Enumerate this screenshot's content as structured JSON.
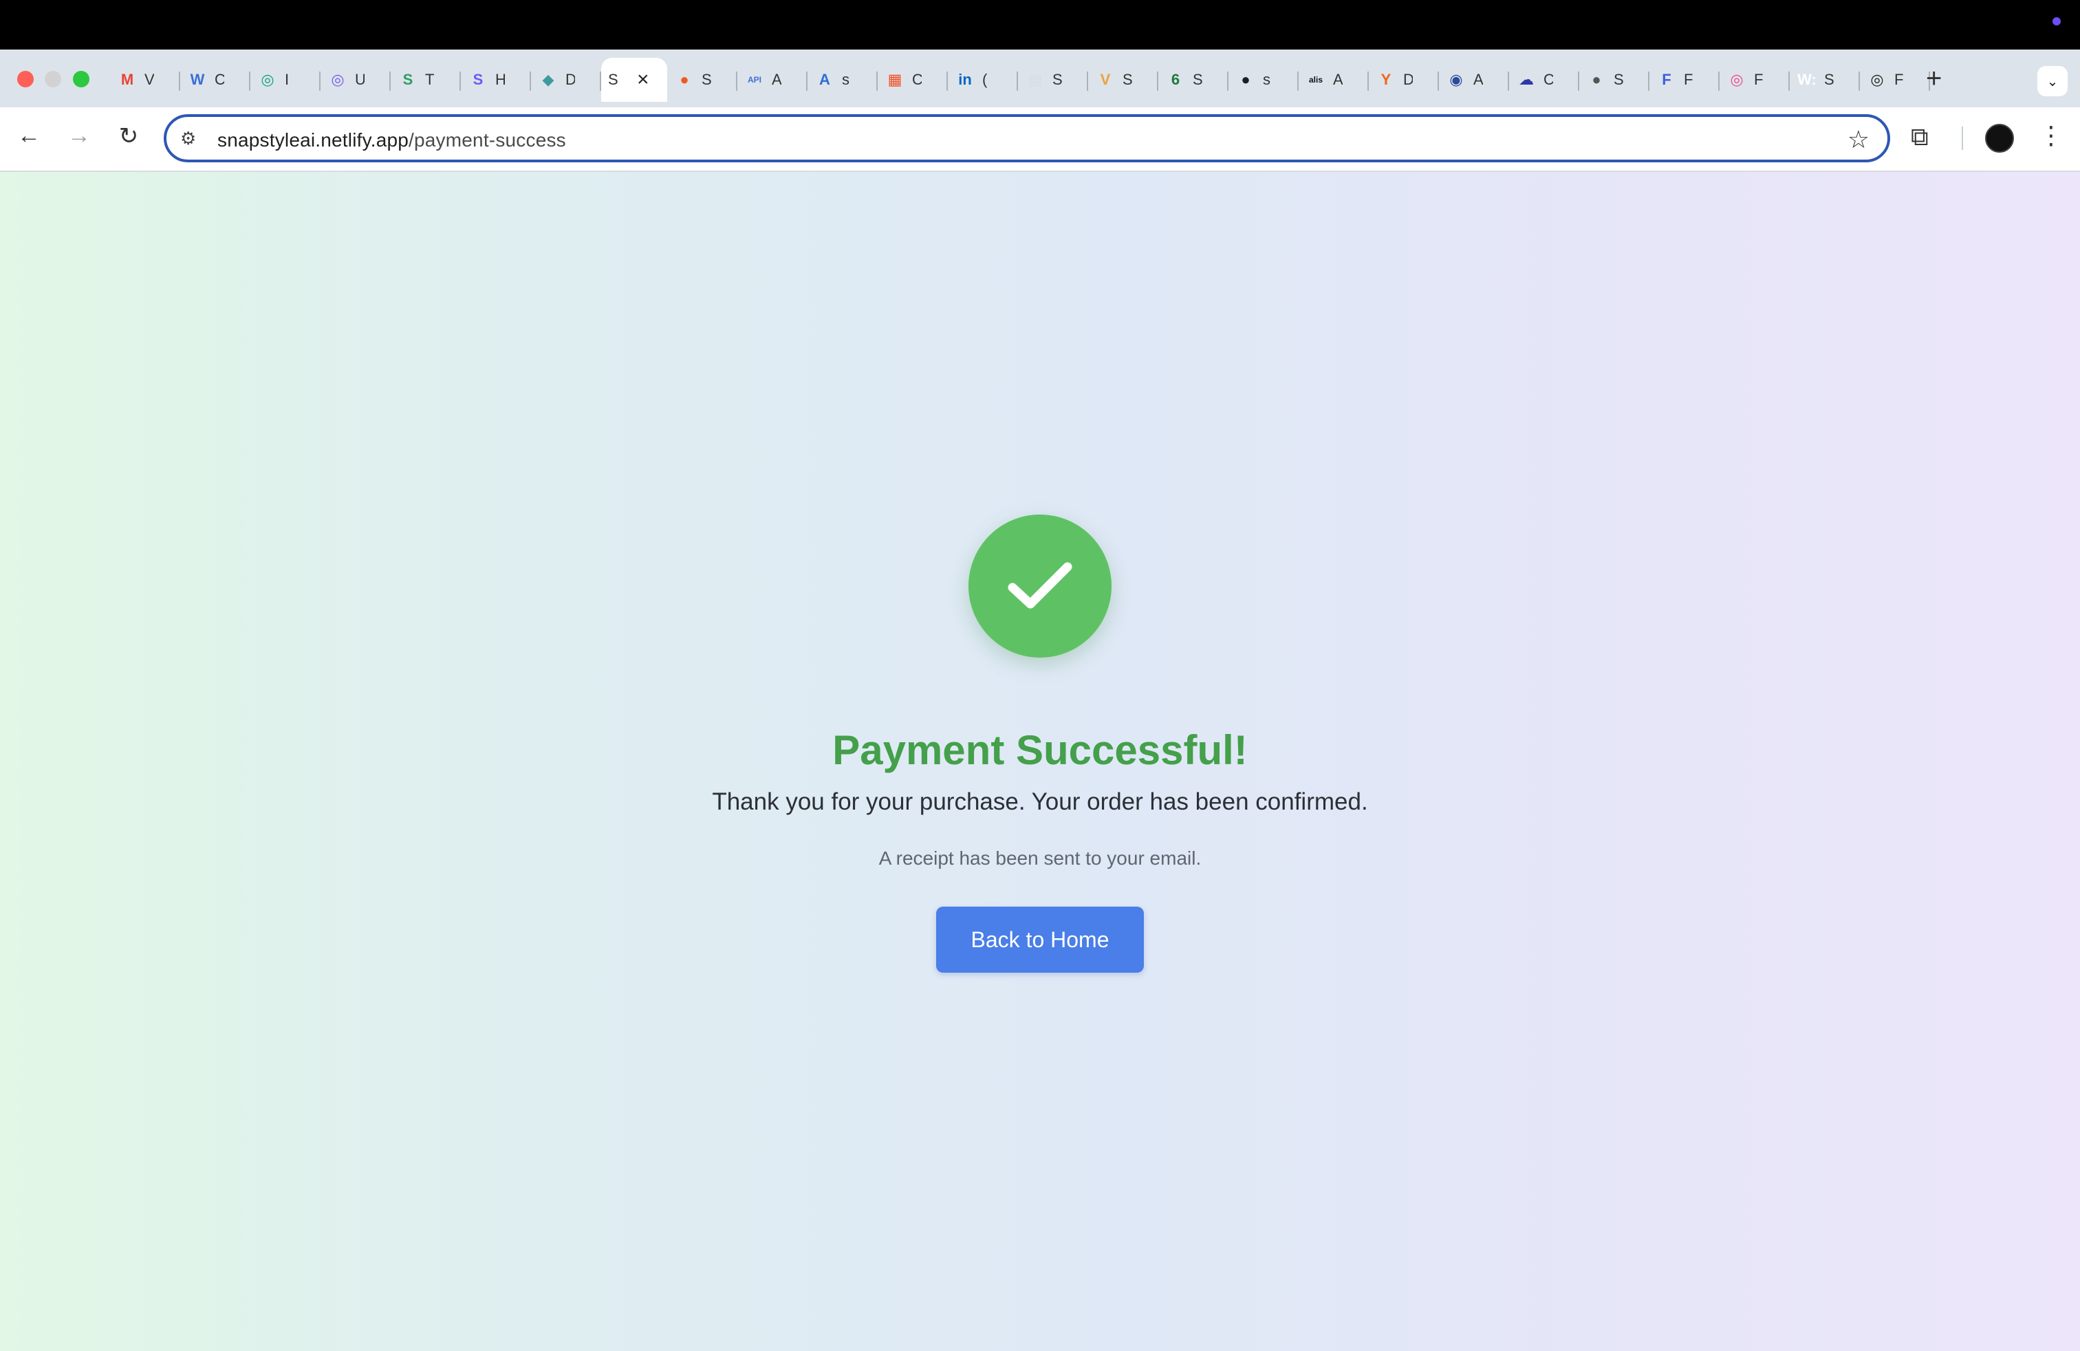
{
  "browser": {
    "tabs": [
      {
        "title": "V",
        "icon": "gmail-icon",
        "color": "#ea4335",
        "glyph": "M",
        "active": false
      },
      {
        "title": "C",
        "icon": "w-logo-icon",
        "color": "#3b6fd8",
        "glyph": "W",
        "active": false
      },
      {
        "title": "I",
        "icon": "openai-icon",
        "color": "#10a37f",
        "glyph": "◎",
        "active": false
      },
      {
        "title": "U",
        "icon": "spiral-icon",
        "color": "#7a5cf0",
        "glyph": "◎",
        "active": false
      },
      {
        "title": "T",
        "icon": "s-logo-icon",
        "color": "#2f9e63",
        "glyph": "S",
        "active": false
      },
      {
        "title": "H",
        "icon": "s-logo-purple-icon",
        "color": "#6a5cf6",
        "glyph": "S",
        "active": false
      },
      {
        "title": "D",
        "icon": "diamond-icon",
        "color": "#3f9aa0",
        "glyph": "◆",
        "active": false
      },
      {
        "title": "S",
        "icon": "active-tab-icon",
        "color": "#ffffff",
        "glyph": "",
        "active": true
      },
      {
        "title": "S",
        "icon": "flame-icon",
        "color": "#f05a22",
        "glyph": "●",
        "active": false
      },
      {
        "title": "A",
        "icon": "api-icon",
        "color": "#3d6fd6",
        "glyph": "API",
        "active": false
      },
      {
        "title": "s",
        "icon": "azure-icon",
        "color": "#2b6fd6",
        "glyph": "A",
        "active": false
      },
      {
        "title": "C",
        "icon": "microsoft-icon",
        "color": "#f25022",
        "glyph": "▦",
        "active": false
      },
      {
        "title": "(",
        "icon": "linkedin-icon",
        "color": "#0a66c2",
        "glyph": "in",
        "active": false
      },
      {
        "title": "S",
        "icon": "document-icon",
        "color": "#d8dde3",
        "glyph": "▤",
        "active": false
      },
      {
        "title": "S",
        "icon": "v-logo-icon",
        "color": "#e8a33b",
        "glyph": "V",
        "active": false
      },
      {
        "title": "S",
        "icon": "leaf-icon",
        "color": "#1f7a3a",
        "glyph": "6",
        "active": false
      },
      {
        "title": "s",
        "icon": "github-icon",
        "color": "#1b1f24",
        "glyph": "●",
        "active": false
      },
      {
        "title": "A",
        "icon": "alis-icon",
        "color": "#111111",
        "glyph": "alis",
        "active": false
      },
      {
        "title": "D",
        "icon": "y-combinator-icon",
        "color": "#f26522",
        "glyph": "Y",
        "active": false
      },
      {
        "title": "A",
        "icon": "globe-icon",
        "color": "#2c4a9a",
        "glyph": "◉",
        "active": false
      },
      {
        "title": "C",
        "icon": "cloud-icon",
        "color": "#2a3aa8",
        "glyph": "☁",
        "active": false
      },
      {
        "title": "S",
        "icon": "globe-dark-icon",
        "color": "#555555",
        "glyph": "●",
        "active": false
      },
      {
        "title": "F",
        "icon": "forms-icon",
        "color": "#3d5ee0",
        "glyph": "F",
        "active": false
      },
      {
        "title": "F",
        "icon": "dribbble-icon",
        "color": "#ea4c89",
        "glyph": "◎",
        "active": false
      },
      {
        "title": "S",
        "icon": "w-square-icon",
        "color": "#ffffff",
        "glyph": "W:",
        "active": false
      },
      {
        "title": "F",
        "icon": "openai-dark-icon",
        "color": "#222222",
        "glyph": "◎",
        "active": false
      }
    ],
    "url_host": "snapstyleai.netlify.app",
    "url_path": "/payment-success"
  },
  "page": {
    "headline": "Payment Successful!",
    "message": "Thank you for your purchase. Your order has been confirmed.",
    "receipt_note": "A receipt has been sent to your email.",
    "button_label": "Back to Home"
  },
  "colors": {
    "success_green": "#5ec264",
    "headline_green": "#44a04a",
    "button_blue": "#4a7ee8",
    "omnibox_border": "#2d57b5"
  }
}
